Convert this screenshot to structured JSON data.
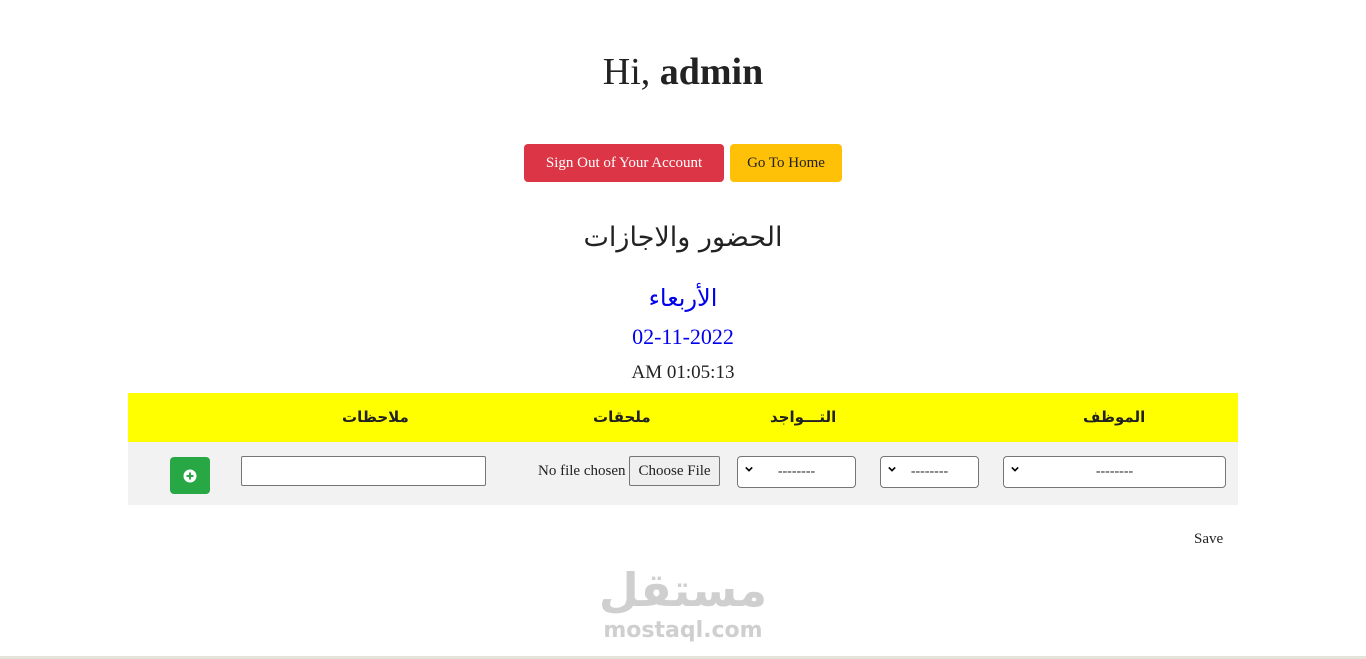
{
  "greeting": {
    "prefix": "Hi,",
    "username": "admin"
  },
  "buttons": {
    "sign_out": "Sign Out of Your Account",
    "go_home": "Go To Home"
  },
  "section_title": "الحضور والاجازات",
  "date_info": {
    "day_name": "الأربعاء",
    "date": "02-11-2022",
    "time": "AM 01:05:13"
  },
  "table": {
    "headers": {
      "employee": "الموظف",
      "presence": "التـــواجد",
      "attachments": "ملحقات",
      "notes": "ملاحظات"
    },
    "row": {
      "employee_select": "--------",
      "type_select": "--------",
      "presence_select": "--------",
      "file_status": "No file chosen",
      "file_button": "Choose File",
      "notes_value": ""
    }
  },
  "save_label": "Save",
  "watermark": {
    "arabic": "مستقل",
    "latin": "mostaql.com"
  },
  "colors": {
    "danger": "#dc3545",
    "warning": "#ffc107",
    "header_bg": "#ffff00",
    "row_bg": "#f2f2f2",
    "success": "#28a745",
    "link_blue": "#0000ee"
  },
  "icons": {
    "add": "plus-circle-icon",
    "select_arrow": "chevron-down-icon"
  }
}
